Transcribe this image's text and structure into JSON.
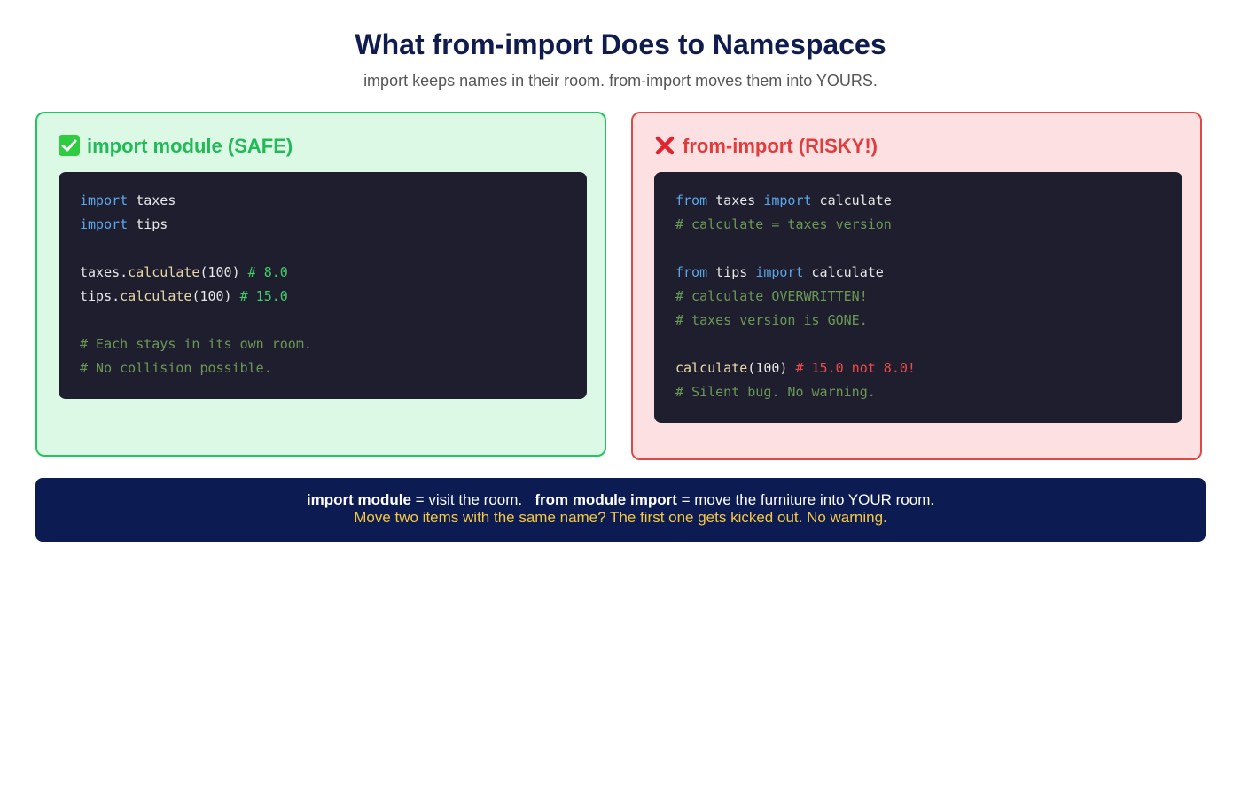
{
  "title": "What from-import Does to Namespaces",
  "subtitle": "import keeps names in their room. from-import moves them into YOURS.",
  "colors": {
    "title": "#0f1c4d",
    "safe_accent": "#22c55e",
    "safe_bg": "#dcf9e6",
    "risky_accent": "#e04848",
    "risky_bg": "#fde1e2",
    "code_bg": "#1f1e2e",
    "keyword": "#5aa7e8",
    "comment": "#6a9955",
    "banner_bg": "#0c1b52",
    "banner_highlight": "#f5c842"
  },
  "safe_panel": {
    "icon": "check-mark-icon",
    "heading": "import module (SAFE)",
    "code": {
      "line1_kw": "import",
      "line1_id": " taxes",
      "line2_kw": "import",
      "line2_id": " tips",
      "line3_obj": "taxes.",
      "line3_fn": "calculate",
      "line3_args": "(100) ",
      "line3_comment": "# 8.0",
      "line4_obj": "tips.",
      "line4_fn": "calculate",
      "line4_args": "(100) ",
      "line4_comment": "# 15.0",
      "line5_comment": "# Each stays in its own room.",
      "line6_comment": "# No collision possible."
    }
  },
  "risky_panel": {
    "icon": "cross-mark-icon",
    "heading": "from-import (RISKY!)",
    "code": {
      "line1_kw1": "from",
      "line1_mod": " taxes ",
      "line1_kw2": "import",
      "line1_name": " calculate",
      "line2_comment": "# calculate = taxes version",
      "line3_kw1": "from",
      "line3_mod": " tips ",
      "line3_kw2": "import",
      "line3_name": " calculate",
      "line4_comment": "# calculate OVERWRITTEN!",
      "line5_comment": "# taxes version is GONE.",
      "line6_fn": "calculate",
      "line6_args": "(100) ",
      "line6_comment": "# 15.0 not 8.0!",
      "line7_comment": "# Silent bug. No warning."
    }
  },
  "footer": {
    "term1": "import module",
    "def1": " = visit the room.   ",
    "term2": "from module import",
    "def2": " = move the furniture into YOUR room.",
    "warning": "Move two items with the same name? The first one gets kicked out. No warning."
  }
}
